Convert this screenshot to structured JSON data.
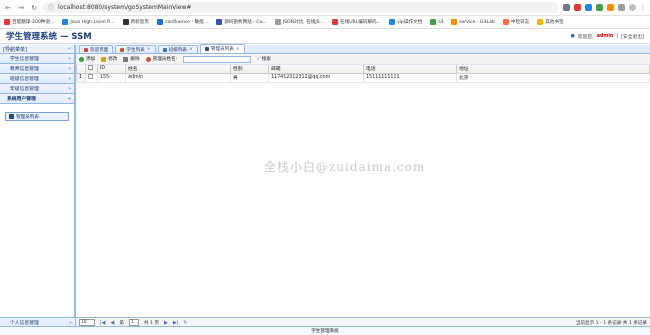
{
  "browser": {
    "url": "localhost:8080/system/goSystemMainView#",
    "bookmarks": [
      "百度翻译-200种语...",
      "Java High Level R...",
      "新标签页",
      "confluence - 敏能...",
      "源码剖析网站 - Co...",
      "JSON对比, 在线JS...",
      "在线URL编码解码...",
      "vip操作文档",
      "UI",
      "service · GitLab",
      "中检日志",
      "其他书签"
    ],
    "colors": [
      "#e53935",
      "#1e88e5",
      "#333333",
      "#1976d2",
      "#3f51b5",
      "#9e9e9e",
      "#e53935",
      "#1e88e5",
      "#43a047",
      "#fb8c00",
      "#ff7043",
      "#ffb300"
    ]
  },
  "app": {
    "title": "学生管理系统 — SSM",
    "welcome_label": "欢迎您,",
    "username": "admin",
    "logout": "[安全退出]"
  },
  "sidebar": {
    "header": "[导航菜单]",
    "items": [
      "学生信息管理",
      "教师信息管理",
      "班级信息管理",
      "年级信息管理",
      "系统用户管理"
    ],
    "active_index": 4,
    "sub_item": "管理员列表",
    "bottom": "个人信息管理"
  },
  "tabs": [
    {
      "label": "欢迎页面",
      "closable": false
    },
    {
      "label": "学生列表",
      "closable": true
    },
    {
      "label": "班级列表",
      "closable": true
    },
    {
      "label": "管理员列表",
      "closable": true
    }
  ],
  "toolbar": {
    "add": "添加",
    "edit": "修改",
    "delete": "删除",
    "name_label": "管理员姓名:",
    "search": "搜索"
  },
  "table": {
    "columns": [
      "ID",
      "姓名",
      "性别",
      "邮箱",
      "电话",
      "地址"
    ],
    "rows": [
      {
        "num": "1",
        "id": "155",
        "name": "admin",
        "gender": "男",
        "email": "117412312312@qq.com",
        "phone": "15111111111",
        "address": "北京"
      }
    ]
  },
  "watermark": "全栈小白@zuidaima.com",
  "pager": {
    "page_size": "10",
    "page_label_pre": "第",
    "page_value": "1",
    "page_label_post": "共 1 页",
    "info": "当前显示 1 - 1 条记录 共 1 条记录"
  },
  "footer": "学生管理系统"
}
